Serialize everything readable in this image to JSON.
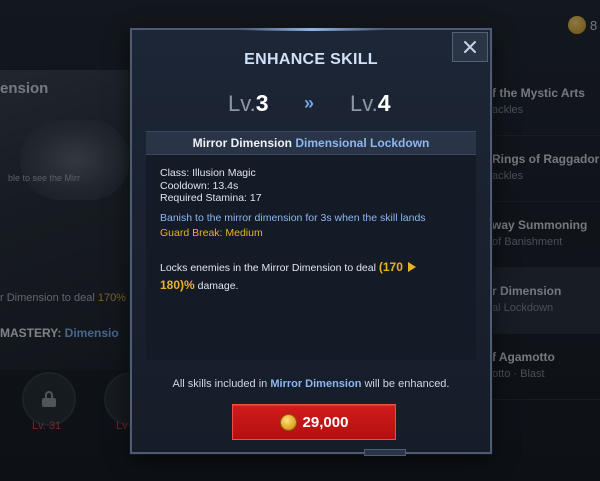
{
  "background": {
    "left_title": "ension",
    "left_caption": "ble to see the Mirr",
    "left_desc_prefix": "r Dimension to deal ",
    "left_desc_value": "170%",
    "mastery_label": "MASTERY: ",
    "mastery_value": "Dimensio",
    "lock_level": "Lv. 31",
    "lock_level2": "Lv",
    "currency_amount": "8",
    "right_list": [
      {
        "title": "f the Mystic Arts",
        "subtitle": "ackles"
      },
      {
        "title": "Rings of Raggadorr",
        "subtitle": "ackles"
      },
      {
        "title": "way Summoning",
        "subtitle": "of Banishment"
      },
      {
        "title": "r Dimension",
        "subtitle": "al Lockdown"
      },
      {
        "title": "f Agamotto",
        "subtitle": "otto · Blast"
      }
    ]
  },
  "modal": {
    "title": "ENHANCE SKILL",
    "level_prefix": "Lv.",
    "level_from": "3",
    "level_to": "4",
    "arrow": "»",
    "skill_name": "Mirror Dimension",
    "skill_subname": "Dimensional Lockdown",
    "info": {
      "class": "Class: Illusion Magic",
      "cooldown": "Cooldown: 13.4s",
      "stamina": "Required Stamina: 17"
    },
    "skill_description": "Banish to the mirror dimension for 3s when the skill lands",
    "guard_break": "Guard Break: Medium",
    "enhance_prefix": "Locks enemies in the Mirror Dimension to deal ",
    "enhance_value_from": "(170",
    "enhance_value_to": "180)%",
    "enhance_suffix": " damage.",
    "note_prefix": "All skills included in ",
    "note_skill": "Mirror Dimension",
    "note_suffix": " will be enhanced.",
    "cost": "29,000"
  },
  "colors": {
    "accent_blue": "#8cb7f0",
    "gold": "#e7b229",
    "button_red": "#c41515",
    "lock_red": "#d33b3b"
  },
  "icons": {
    "close": "close-icon",
    "coin": "gold-coin-icon",
    "lock": "lock-icon"
  }
}
